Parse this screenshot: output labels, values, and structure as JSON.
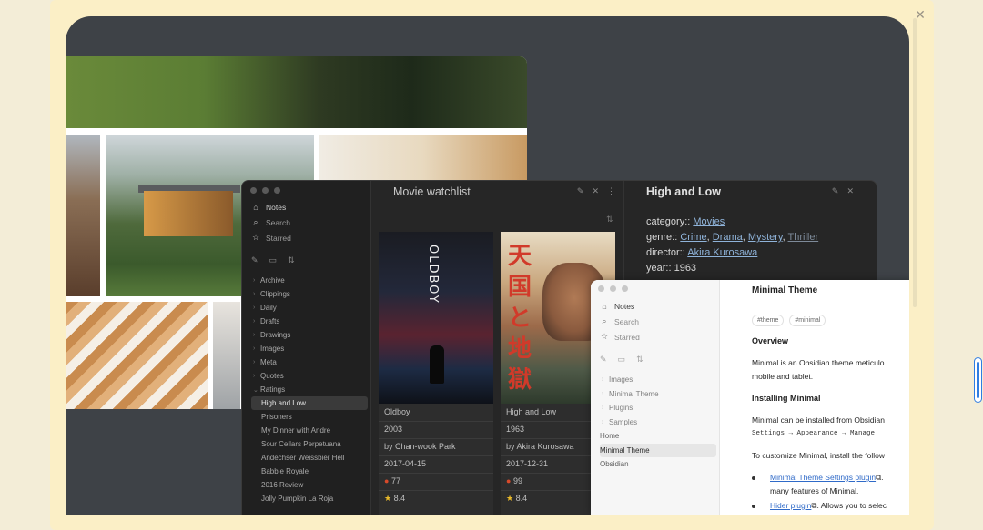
{
  "dialog": {
    "close_glyph": "✕"
  },
  "watchlist": {
    "sidebar": {
      "top": [
        {
          "icon": "home-icon",
          "glyph": "⌂",
          "label": "Notes"
        },
        {
          "icon": "search-icon",
          "glyph": "⌕",
          "label": "Search"
        },
        {
          "icon": "star-icon",
          "glyph": "☆",
          "label": "Starred"
        }
      ],
      "folders": [
        "Archive",
        "Clippings",
        "Daily",
        "Drafts",
        "Drawings",
        "Images",
        "Meta",
        "Quotes"
      ],
      "ratings_folder": "Ratings",
      "rating_notes": [
        "High and Low",
        "Prisoners",
        "My Dinner with Andre",
        "Sour Cellars Perpetuana",
        "Andechser Weissbier Hell",
        "Babble Royale",
        "2016 Review",
        "Jolly Pumpkin La Roja"
      ]
    },
    "title": "Movie watchlist",
    "cards": [
      {
        "poster_title": "OLDBOY",
        "title": "Oldboy",
        "year": "2003",
        "director": "by Chan-wook Park",
        "date": "2017-04-15",
        "score": "77",
        "rating": "8.4"
      },
      {
        "poster_kanji": "天国と地獄",
        "title": "High and Low",
        "year": "1963",
        "director": "by Akira Kurosawa",
        "date": "2017-12-31",
        "score": "99",
        "rating": "8.4"
      }
    ]
  },
  "note": {
    "title": "High and Low",
    "category_key": "category::",
    "category": "Movies",
    "genre_key": "genre::",
    "genres": [
      "Crime",
      "Drama",
      "Mystery",
      "Thriller"
    ],
    "director_key": "director::",
    "director": "Akira Kurosawa",
    "year_key": "year::",
    "year": "1963"
  },
  "minimal": {
    "sidebar": {
      "top": [
        {
          "icon": "home-icon",
          "glyph": "⌂",
          "label": "Notes"
        },
        {
          "icon": "search-icon",
          "glyph": "⌕",
          "label": "Search"
        },
        {
          "icon": "star-icon",
          "glyph": "☆",
          "label": "Starred"
        }
      ],
      "folders": [
        "Images",
        "Minimal Theme",
        "Plugins",
        "Samples"
      ],
      "files": [
        "Home",
        "Minimal Theme",
        "Obsidian"
      ]
    },
    "doc": {
      "title": "Minimal Theme",
      "tags": [
        "#theme",
        "#minimal"
      ],
      "overview_heading": "Overview",
      "overview_line1": "Minimal is an Obsidian theme meticulo",
      "overview_line2": "mobile and tablet.",
      "install_heading": "Installing Minimal",
      "install_line": "Minimal can be installed from Obsidian",
      "install_path": "Settings → Appearance → Manage",
      "customize_line": "To customize Minimal, install the follow",
      "plugin1_link": "Minimal Theme Settings plugin",
      "plugin1_rest": ".",
      "plugin1_line2": "many features of Minimal.",
      "plugin2_link": "Hider plugin",
      "plugin2_rest": ". Allows you to selec"
    }
  }
}
